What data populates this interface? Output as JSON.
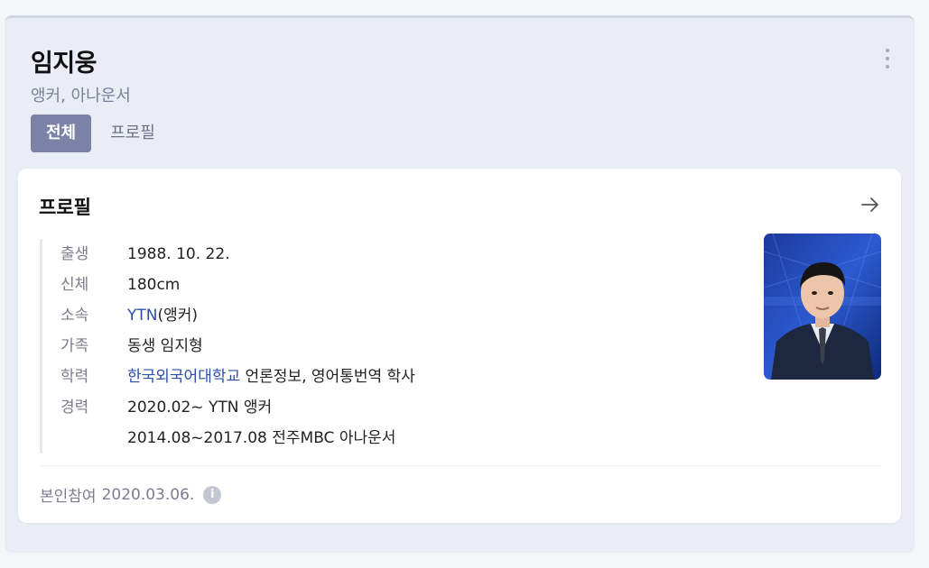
{
  "header": {
    "name": "임지웅",
    "role": "앵커, 아나운서",
    "more_icon": "more-vertical-icon"
  },
  "tabs": [
    {
      "label": "전체",
      "active": true
    },
    {
      "label": "프로필",
      "active": false
    }
  ],
  "profile": {
    "title": "프로필",
    "arrow_icon": "arrow-right-icon",
    "rows": [
      {
        "label": "출생",
        "value": "1988. 10. 22."
      },
      {
        "label": "신체",
        "value": "180cm"
      },
      {
        "label": "소속",
        "link": "YTN",
        "value": "(앵커)"
      },
      {
        "label": "가족",
        "value": "동생 임지형"
      },
      {
        "label": "학력",
        "link": "한국외국어대학교",
        "value": " 언론정보, 영어통번역 학사"
      },
      {
        "label": "경력",
        "lines": [
          "2020.02~ YTN 앵커",
          "2014.08~2017.08 전주MBC 아나운서"
        ]
      }
    ],
    "footer_label": "본인참여",
    "footer_date": "2020.03.06.",
    "info_icon": "info-icon"
  },
  "colors": {
    "accent": "#7c81a6",
    "link": "#2b4fa8",
    "panel_bg": "#ebedf6"
  }
}
